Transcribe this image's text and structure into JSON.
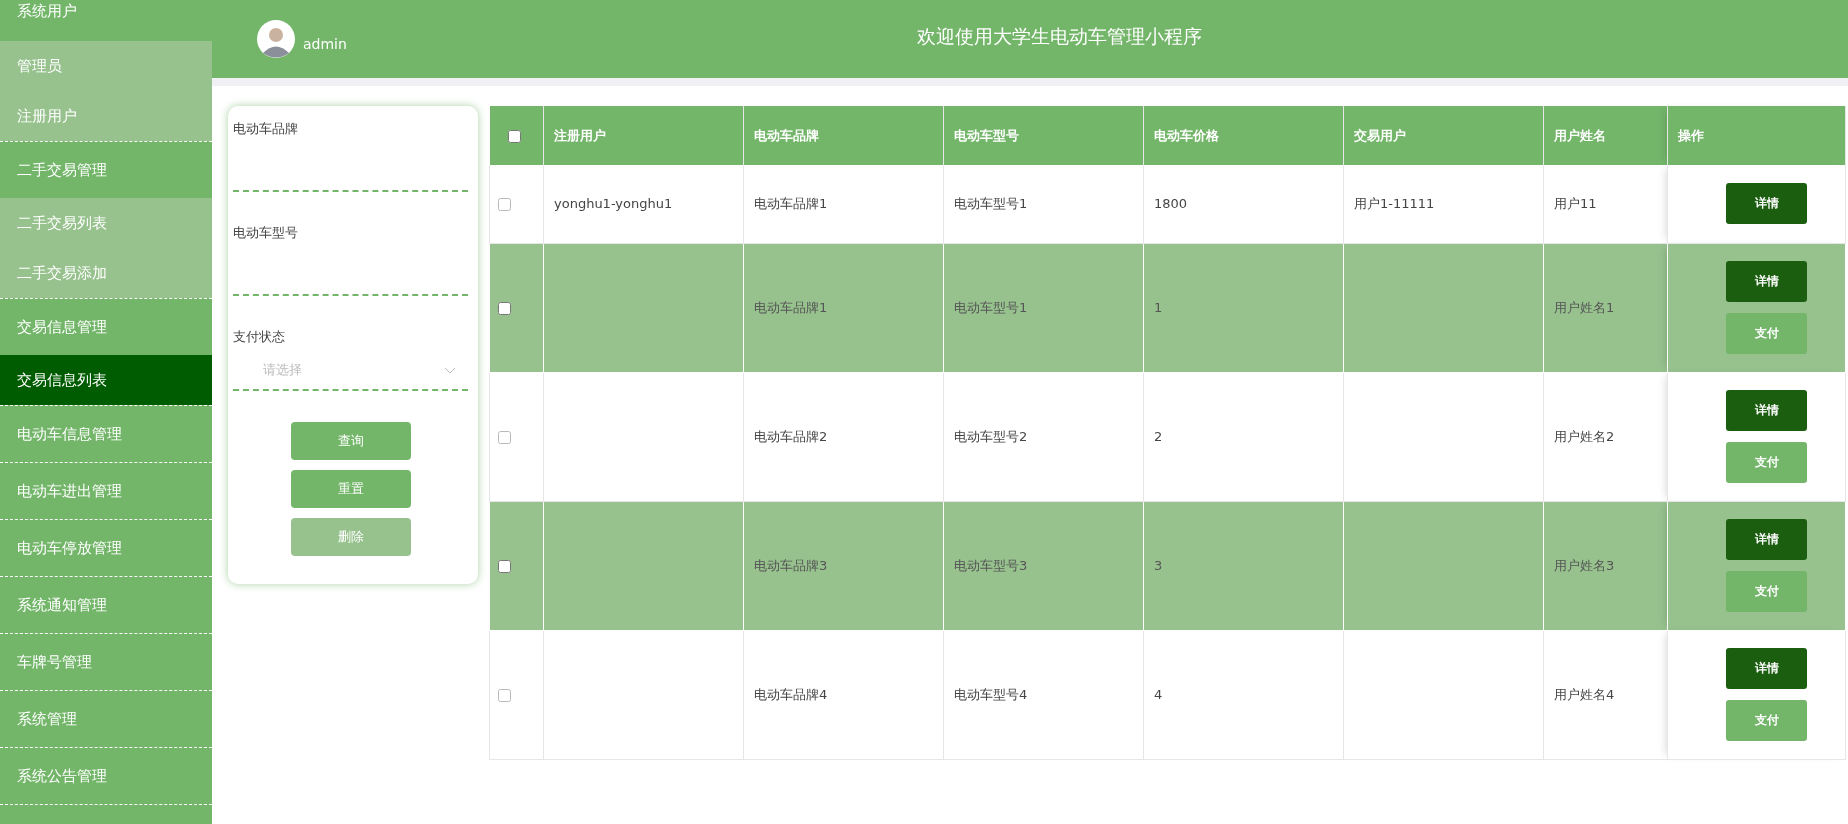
{
  "sidebar": {
    "items": [
      {
        "label": "系统用户",
        "selected": false,
        "expanded": true,
        "children": [
          {
            "label": "管理员",
            "selected": false
          },
          {
            "label": "注册用户",
            "selected": false
          }
        ]
      },
      {
        "label": "二手交易管理",
        "selected": false,
        "expanded": true,
        "children": [
          {
            "label": "二手交易列表",
            "selected": false
          },
          {
            "label": "二手交易添加",
            "selected": false
          }
        ]
      },
      {
        "label": "交易信息管理",
        "selected": false,
        "expanded": true,
        "children": [
          {
            "label": "交易信息列表",
            "selected": true
          }
        ]
      },
      {
        "label": "电动车信息管理",
        "selected": false
      },
      {
        "label": "电动车进出管理",
        "selected": false
      },
      {
        "label": "电动车停放管理",
        "selected": false
      },
      {
        "label": "系统通知管理",
        "selected": false
      },
      {
        "label": "车牌号管理",
        "selected": false
      },
      {
        "label": "系统管理",
        "selected": false
      },
      {
        "label": "系统公告管理",
        "selected": false
      }
    ]
  },
  "header": {
    "user": "admin",
    "title": "欢迎使用大学生电动车管理小程序"
  },
  "filters": {
    "fields": [
      {
        "kind": "text",
        "label": "电动车品牌"
      },
      {
        "kind": "text",
        "label": "电动车型号"
      },
      {
        "kind": "select",
        "label": "支付状态",
        "placeholder": "请选择"
      }
    ],
    "buttons": [
      {
        "label": "查询",
        "kind": "primary"
      },
      {
        "label": "重置",
        "kind": "primary"
      },
      {
        "label": "删除",
        "kind": "muted"
      }
    ]
  },
  "table": {
    "select_all": {
      "checked": false
    },
    "columns": [
      "注册用户",
      "电动车品牌",
      "电动车型号",
      "电动车价格",
      "交易用户",
      "用户姓名",
      "操作"
    ],
    "rows": [
      {
        "checked": false,
        "cells": [
          "yonghu1-yonghu1",
          "电动车品牌1",
          "电动车型号1",
          "1800",
          "用户1-11111",
          "用户11"
        ],
        "actions": [
          {
            "kind": "detail",
            "label": "详情"
          }
        ]
      },
      {
        "checked": false,
        "cells": [
          "",
          "电动车品牌1",
          "电动车型号1",
          "1",
          "",
          "用户姓名1"
        ],
        "actions": [
          {
            "kind": "detail",
            "label": "详情"
          },
          {
            "kind": "pay",
            "label": "支付"
          }
        ]
      },
      {
        "checked": false,
        "cells": [
          "",
          "电动车品牌2",
          "电动车型号2",
          "2",
          "",
          "用户姓名2"
        ],
        "actions": [
          {
            "kind": "detail",
            "label": "详情"
          },
          {
            "kind": "pay",
            "label": "支付"
          }
        ]
      },
      {
        "checked": false,
        "cells": [
          "",
          "电动车品牌3",
          "电动车型号3",
          "3",
          "",
          "用户姓名3"
        ],
        "actions": [
          {
            "kind": "detail",
            "label": "详情"
          },
          {
            "kind": "pay",
            "label": "支付"
          }
        ]
      },
      {
        "checked": false,
        "cells": [
          "",
          "电动车品牌4",
          "电动车型号4",
          "4",
          "",
          "用户姓名4"
        ],
        "actions": [
          {
            "kind": "detail",
            "label": "详情"
          },
          {
            "kind": "pay",
            "label": "支付"
          }
        ]
      }
    ]
  }
}
